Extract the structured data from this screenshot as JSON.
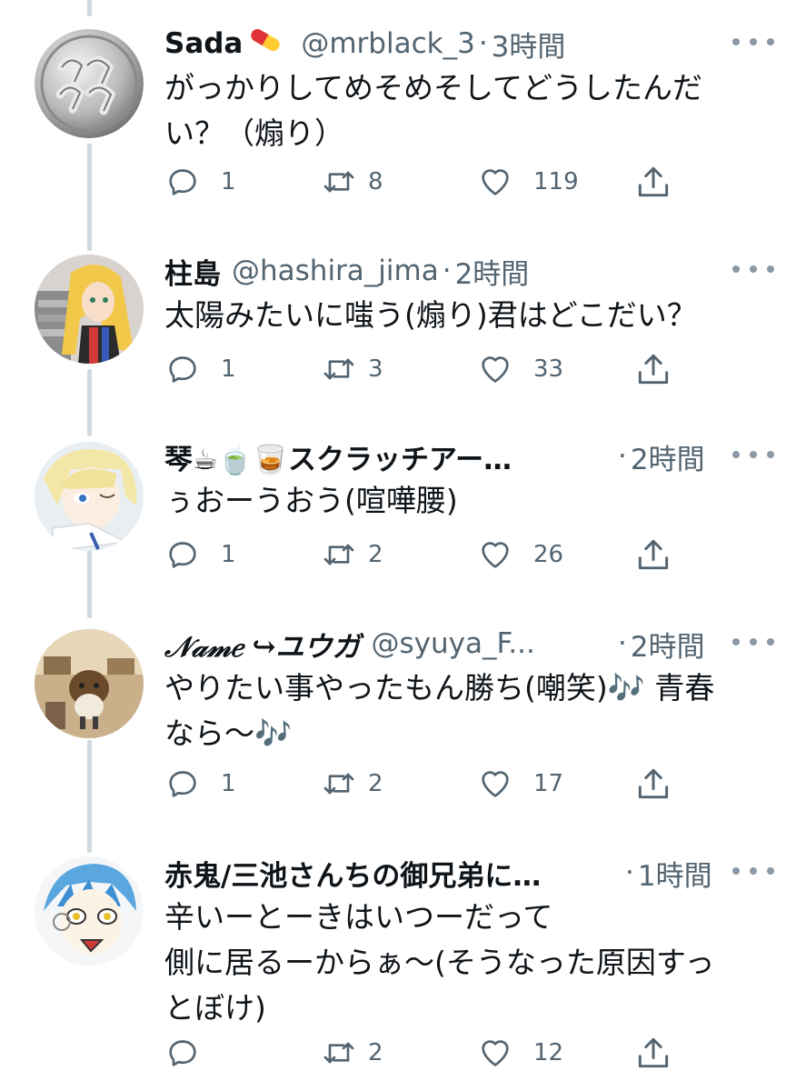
{
  "tweets": [
    {
      "name": "Sada",
      "name_emoji": "pill-icon",
      "handle": "@mrblack_3",
      "time": "3時間",
      "text": "がっかりしてめそめそしてどうしたんだ\nい？（煽り）",
      "replies": "1",
      "retweets": "8",
      "likes": "119"
    },
    {
      "name": "柱島",
      "handle": "@hashira_jima",
      "time": "2時間",
      "text": "太陽みたいに嗤う(煽り)君はどこだい？",
      "replies": "1",
      "retweets": "3",
      "likes": "33"
    },
    {
      "name": "琴☕🍵🥃スクラッチアー…",
      "handle": "",
      "time": "2時間",
      "text": "ぅおーうおう(喧嘩腰)",
      "replies": "1",
      "retweets": "2",
      "likes": "26"
    },
    {
      "name": "𝒩𝒶𝓂𝑒 ↪ユウガ",
      "handle": "@syuya_F...",
      "time": "2時間",
      "text": "やりたい事やったもん勝ち(嘲笑)🎶 青春\nなら〜🎶",
      "replies": "1",
      "retweets": "2",
      "likes": "17"
    },
    {
      "name": "赤鬼/三池さんちの御兄弟に…",
      "handle": "",
      "time": "1時間",
      "text": "辛いーとーきはいつーだって\n側に居るーからぁ〜(そうなった原因すっ\nとぼけ)",
      "replies": "",
      "retweets": "2",
      "likes": "12"
    }
  ],
  "separator": "·",
  "colors": {
    "text": "#0f1419",
    "secondary": "#536471",
    "thread_line": "#cfd9de"
  }
}
